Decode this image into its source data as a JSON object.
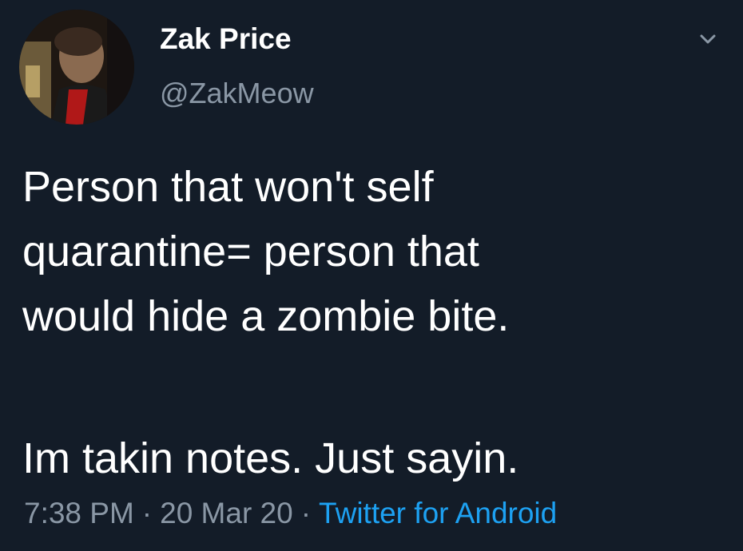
{
  "user": {
    "display_name": "Zak Price",
    "handle": "@ZakMeow",
    "avatar_icon": "user-avatar-photo"
  },
  "tweet": {
    "lines": [
      "Person that won't self",
      "quarantine= person that",
      "would hide a zombie bite.",
      "Im takin notes. Just sayin."
    ]
  },
  "meta": {
    "time": "7:38 PM",
    "separator": "·",
    "date": "20 Mar 20",
    "source": "Twitter for Android"
  },
  "menu_icon": "chevron-down-icon",
  "colors": {
    "background": "#131c28",
    "text": "#ffffff",
    "secondary": "#8a97a5",
    "link": "#1da1f2"
  }
}
